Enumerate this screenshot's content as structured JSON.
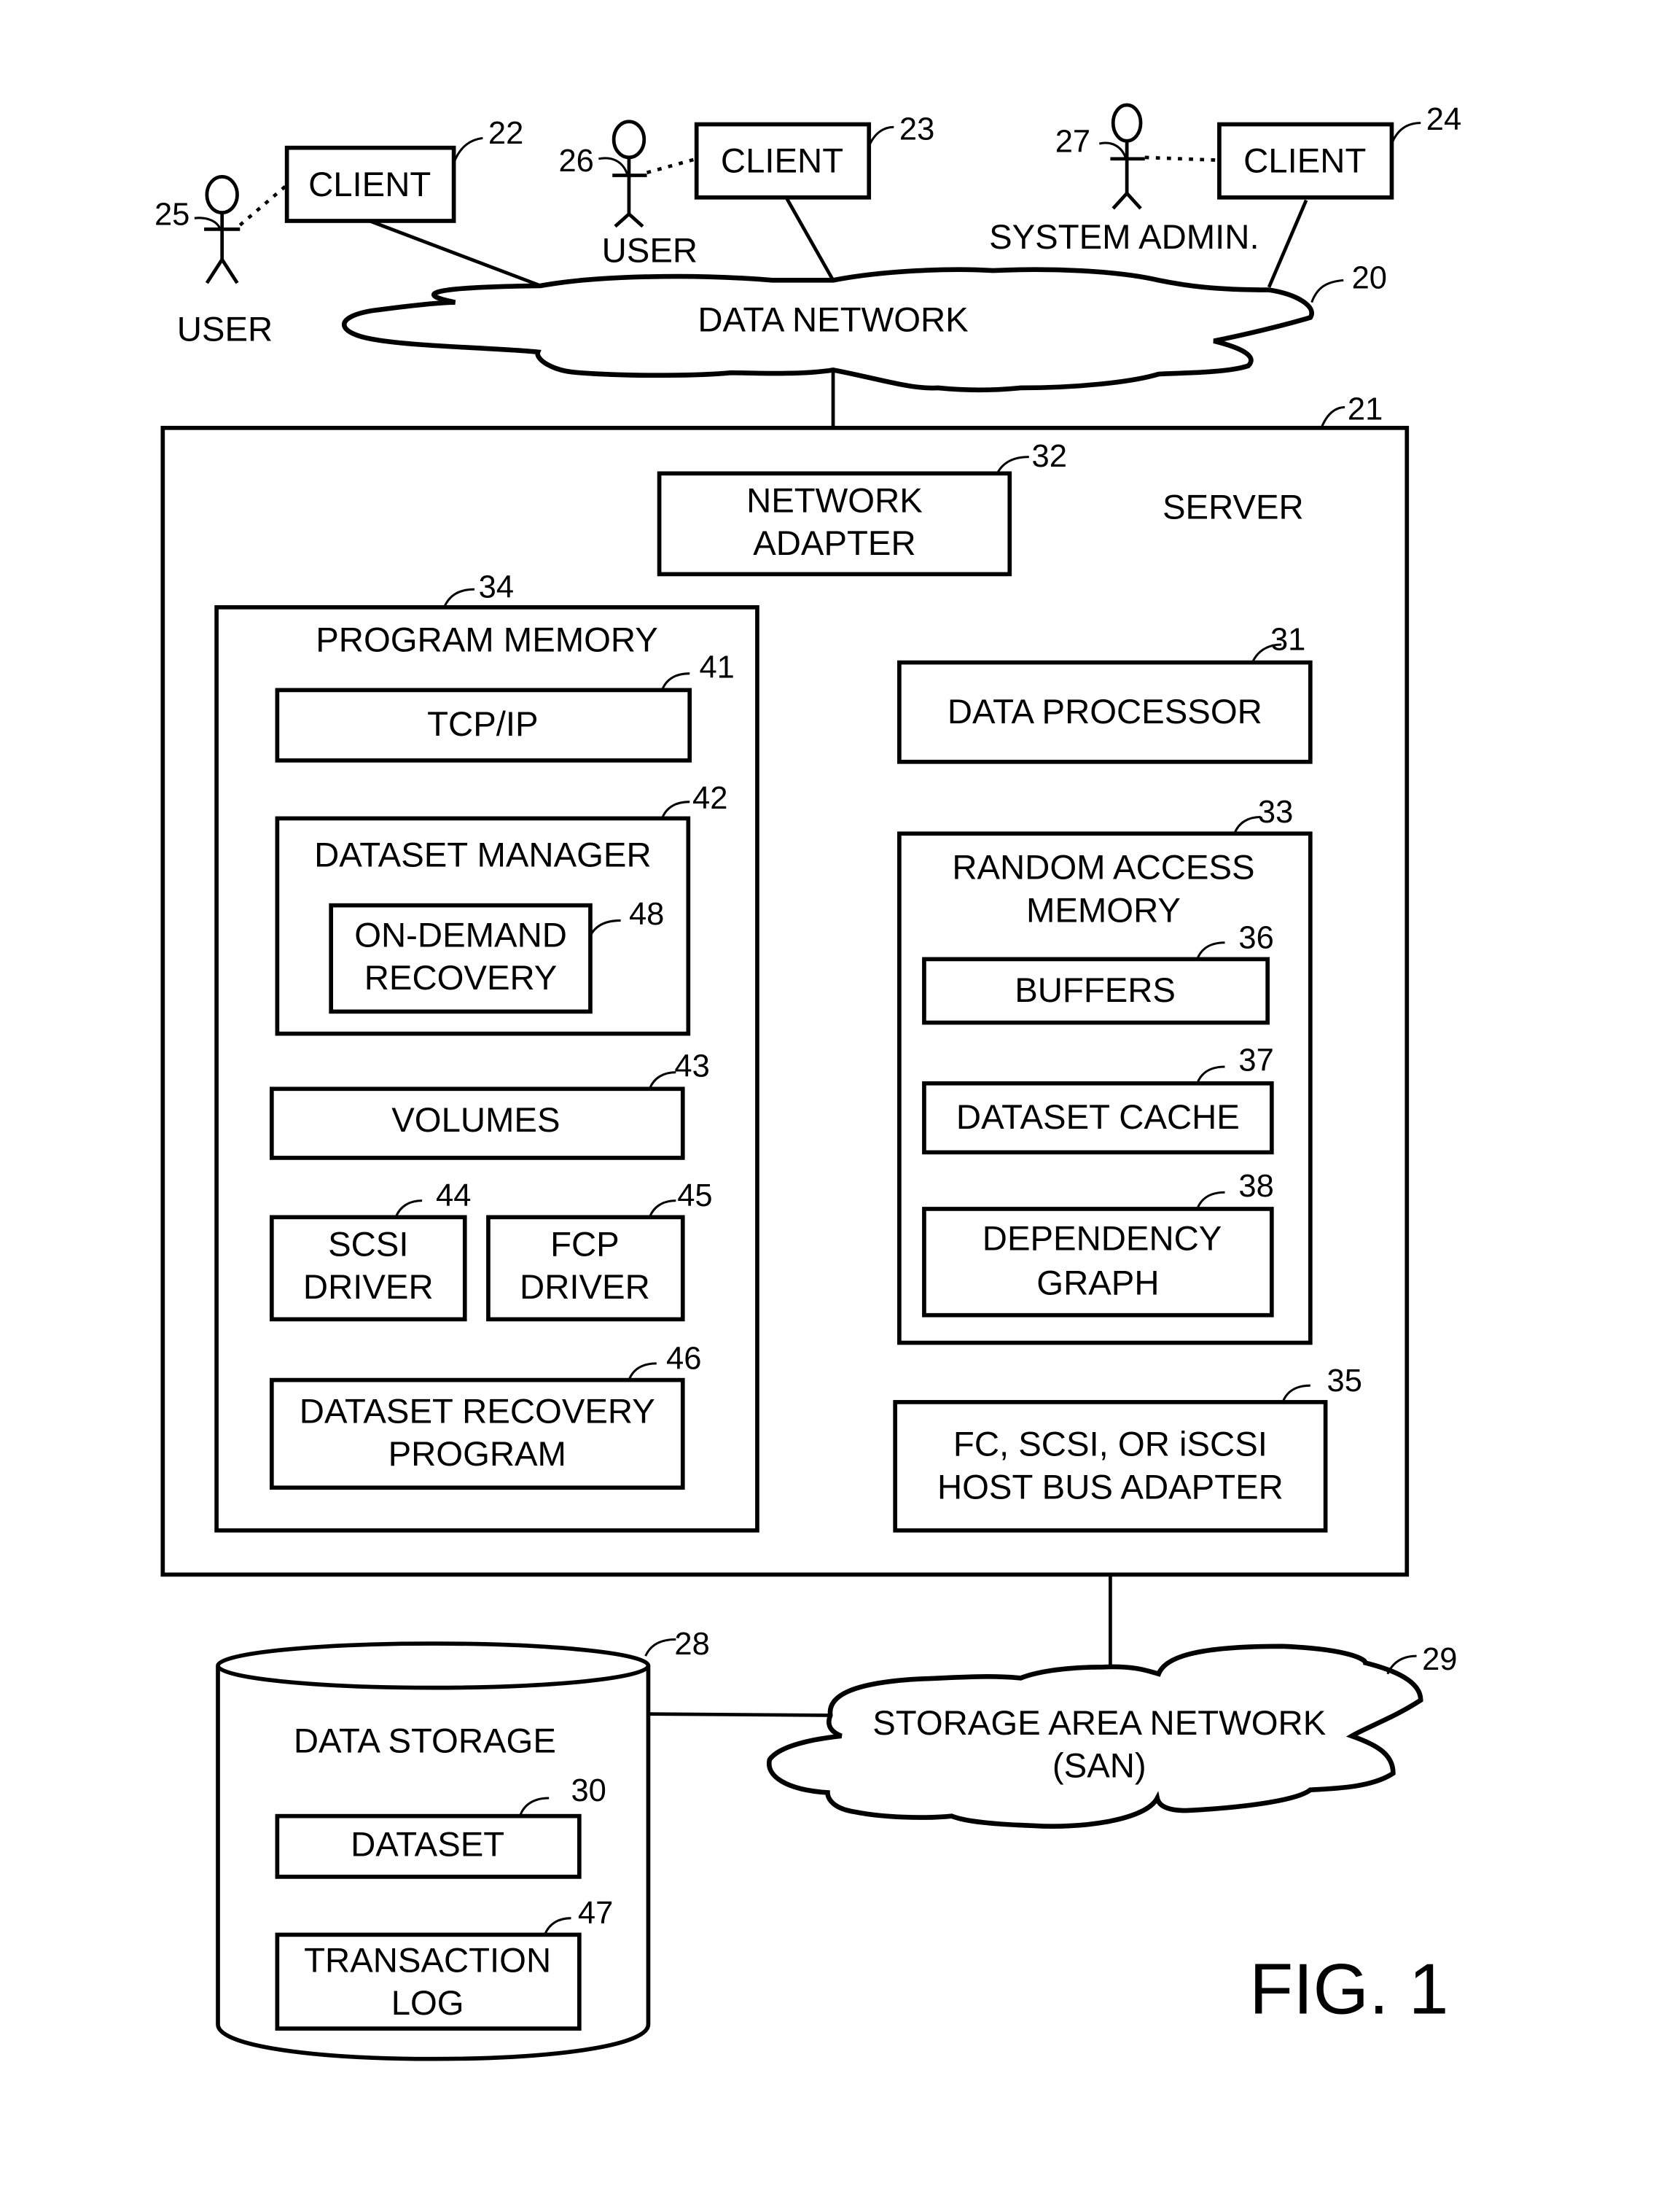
{
  "figure": {
    "caption": "FIG. 1",
    "colors": {
      "ink": "#000000",
      "paper": "#ffffff"
    }
  },
  "clients": [
    {
      "label": "CLIENT",
      "ref": "22"
    },
    {
      "label": "CLIENT",
      "ref": "23"
    },
    {
      "label": "CLIENT",
      "ref": "24"
    }
  ],
  "users": [
    {
      "label": "USER",
      "ref": "25"
    },
    {
      "label": "USER",
      "ref": "26"
    },
    {
      "label": "SYSTEM ADMIN.",
      "ref": "27"
    }
  ],
  "data_network": {
    "label": "DATA  NETWORK",
    "ref": "20"
  },
  "server": {
    "label": "SERVER",
    "ref": "21",
    "network_adapter": {
      "lines": [
        "NETWORK",
        "ADAPTER"
      ],
      "ref": "32"
    },
    "data_processor": {
      "label": "DATA PROCESSOR",
      "ref": "31"
    },
    "program_memory": {
      "label": "PROGRAM MEMORY",
      "ref": "34",
      "tcpip": {
        "label": "TCP/IP",
        "ref": "41"
      },
      "dataset_manager": {
        "label": "DATASET MANAGER",
        "ref": "42",
        "on_demand_recovery": {
          "lines": [
            "ON-DEMAND",
            "RECOVERY"
          ],
          "ref": "48"
        }
      },
      "volumes": {
        "label": "VOLUMES",
        "ref": "43"
      },
      "scsi_driver": {
        "lines": [
          "SCSI",
          "DRIVER"
        ],
        "ref": "44"
      },
      "fcp_driver": {
        "lines": [
          "FCP",
          "DRIVER"
        ],
        "ref": "45"
      },
      "dataset_recovery_program": {
        "lines": [
          "DATASET RECOVERY",
          "PROGRAM"
        ],
        "ref": "46"
      }
    },
    "ram": {
      "lines": [
        "RANDOM ACCESS",
        "MEMORY"
      ],
      "ref": "33",
      "buffers": {
        "label": "BUFFERS",
        "ref": "36"
      },
      "dataset_cache": {
        "label": "DATASET  CACHE",
        "ref": "37"
      },
      "dependency_graph": {
        "lines": [
          "DEPENDENCY",
          "GRAPH"
        ],
        "ref": "38"
      }
    },
    "hba": {
      "lines": [
        "FC, SCSI, OR iSCSI",
        "HOST BUS ADAPTER"
      ],
      "ref": "35"
    }
  },
  "san": {
    "lines": [
      "STORAGE AREA NETWORK",
      "(SAN)"
    ],
    "ref": "29"
  },
  "data_storage": {
    "label": "DATA STORAGE",
    "ref": "28",
    "dataset": {
      "label": "DATASET",
      "ref": "30"
    },
    "transaction_log": {
      "lines": [
        "TRANSACTION",
        "LOG"
      ],
      "ref": "47"
    }
  }
}
